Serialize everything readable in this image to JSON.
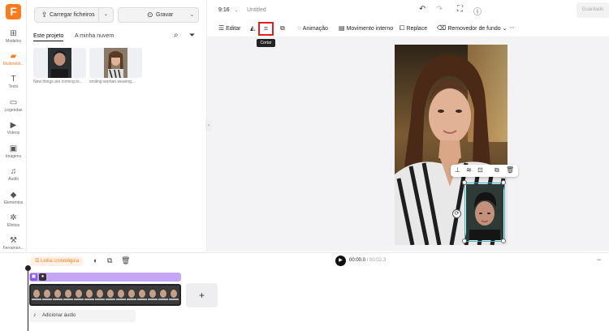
{
  "brand": {
    "logo_letter": "F",
    "accent": "#ff7a1a"
  },
  "rail": [
    {
      "label": "Modelos",
      "icon": "templates-icon"
    },
    {
      "label": "Multimédi...",
      "icon": "media-icon"
    },
    {
      "label": "Texto",
      "icon": "text-icon"
    },
    {
      "label": "Legendas",
      "icon": "captions-icon"
    },
    {
      "label": "Vídeos",
      "icon": "video-icon"
    },
    {
      "label": "Imagens",
      "icon": "image-icon"
    },
    {
      "label": "Áudio",
      "icon": "audio-icon"
    },
    {
      "label": "Elementos",
      "icon": "elements-icon"
    },
    {
      "label": "Efeitos",
      "icon": "effects-icon"
    },
    {
      "label": "Ferramen...",
      "icon": "tools-icon"
    }
  ],
  "panel": {
    "upload_label": "Carregar ficheiros",
    "record_label": "Gravar",
    "tab_project": "Este projeto",
    "tab_cloud": "A minha nuvem",
    "media": [
      {
        "caption": "New things are coming to..."
      },
      {
        "caption": "smiling woman wearing..."
      }
    ]
  },
  "topbar": {
    "aspect_ratio": "9:16",
    "title": "Untitled",
    "saved_label": "Guardado"
  },
  "edit_toolbar": {
    "edit": "Editar",
    "animation": "Animação",
    "motion": "Movimento interno",
    "replace": "Replace",
    "remove_bg": "Removedor de fundo",
    "crop_tooltip": "Cortar"
  },
  "timeline": {
    "chip_label": "Linha cronológica",
    "time_current": "00:00.0",
    "time_total": "/ 00:02.3",
    "add_audio": "Adicionar áudio",
    "add_clip": "+"
  }
}
